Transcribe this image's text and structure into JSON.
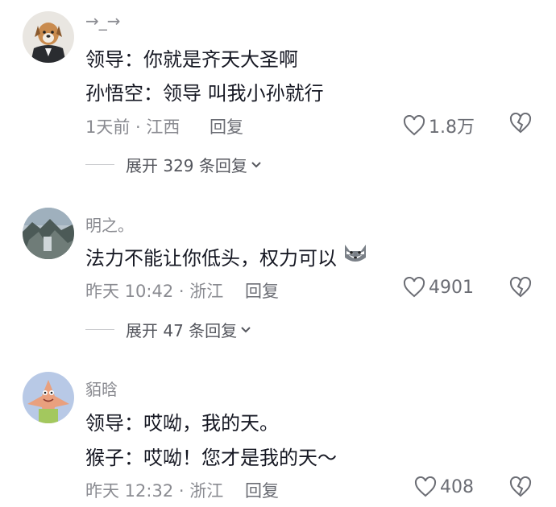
{
  "comments": [
    {
      "username": "→_→",
      "lines": [
        "领导：你就是齐天大圣啊",
        "孙悟空：领导 叫我小孙就行"
      ],
      "meta": "1天前 · 江西",
      "reply_label": "回复",
      "likes": "1.8万",
      "expand_label": "展开 329 条回复"
    },
    {
      "username": "明之。",
      "lines": [
        "法力不能让你低头，权力可以"
      ],
      "meta": "昨天 10:42 · 浙江",
      "reply_label": "回复",
      "likes": "4901",
      "expand_label": "展开 47 条回复"
    },
    {
      "username": "貊晗",
      "lines": [
        "领导：哎呦，我的天。",
        "猴子：哎呦！您才是我的天～"
      ],
      "meta": "昨天 12:32 · 浙江",
      "reply_label": "回复",
      "likes": "408"
    }
  ],
  "icons": {
    "like": "heart-outline-icon",
    "dislike": "broken-heart-icon",
    "expand": "chevron-down-icon",
    "inline_emoji": "husky-dog-emoji"
  }
}
